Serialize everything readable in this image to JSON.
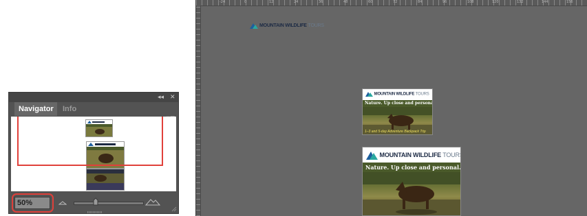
{
  "navigator_panel": {
    "collapse_label": "◂◂",
    "close_label": "✕",
    "tabs": [
      {
        "label": "Navigator",
        "active": true
      },
      {
        "label": "Info",
        "active": false
      }
    ],
    "menu_label": "▾≡",
    "zoom_value": "50%"
  },
  "canvas": {
    "ruler_numbers": [
      "-24",
      "0",
      "12",
      "24",
      "36",
      "48",
      "60",
      "72",
      "84",
      "96",
      "108",
      "120",
      "132",
      "144",
      "156"
    ],
    "logo": {
      "brand_bold": "MOUNTAIN WILDLIFE",
      "brand_thin": "TOURS"
    },
    "small_ad": {
      "brand_bold": "MOUNTAIN WILDLIFE",
      "brand_thin": "TOURS",
      "tagline": "Nature. Up close and personal.",
      "footer": "1–3 and 5-day Adventure Backpack Trip"
    },
    "large_ad": {
      "brand_bold": "MOUNTAIN WILDLIFE",
      "brand_thin": "TOURS",
      "tagline": "Nature. Up close and personal."
    }
  },
  "colors": {
    "highlight_red": "#e0403a",
    "panel_gray": "#535353",
    "canvas_gray": "#666666",
    "brand_navy": "#1c2a44",
    "logo_teal": "#2aa8a0",
    "logo_blue": "#1d5f9e",
    "tagline_bar": "#4a5a2a"
  }
}
